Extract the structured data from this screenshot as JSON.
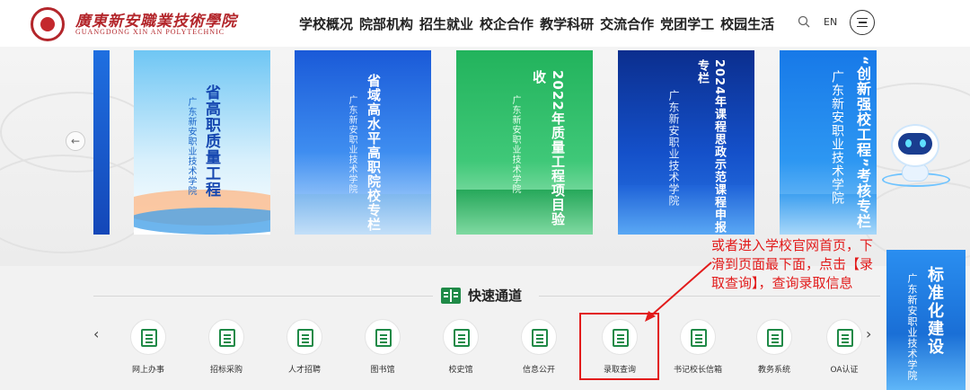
{
  "header": {
    "school_name_cn": "廣東新安職業技術學院",
    "school_name_en": "GUANGDONG XIN AN POLYTECHNIC",
    "nav": [
      "学校概况",
      "院部机构",
      "招生就业",
      "校企合作",
      "教学科研",
      "交流合作",
      "党团学工",
      "校园生活"
    ],
    "lang_label": "EN"
  },
  "banner": {
    "cards": [
      {
        "title": "省高职质量工程",
        "school": "广东新安职业技术学院"
      },
      {
        "title": "省域高水平高职院校专栏",
        "school": "广东新安职业技术学院"
      },
      {
        "title": "2022年质量工程项目验收",
        "school": "广东新安职业技术学院"
      },
      {
        "title": "2024年课程思政示范课程申报专栏",
        "school": "广东新安职业技术学院"
      },
      {
        "title": "“创新强校工程”考核专栏",
        "school": "广东新安职业技术学院"
      }
    ]
  },
  "side_banner": {
    "title": "标准化建设",
    "school": "广东新安职业技术学院"
  },
  "quick_access": {
    "title": "快速通道",
    "items": [
      "网上办事",
      "招标采购",
      "人才招聘",
      "图书馆",
      "校史馆",
      "信息公开",
      "录取查询",
      "书记校长信箱",
      "教务系统",
      "OA认证"
    ]
  },
  "annotation": {
    "text": "或者进入学校官网首页，下滑到页面最下面，点击【录取查询】，查询录取信息"
  },
  "colors": {
    "brand_red": "#b3262b",
    "quick_access_green": "#1f8a47",
    "annotation_red": "#e21b1b"
  }
}
